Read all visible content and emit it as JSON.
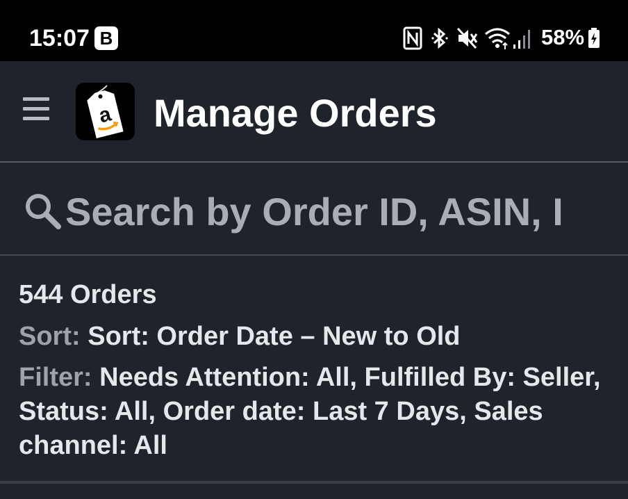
{
  "status_bar": {
    "time": "15:07",
    "badge": "B",
    "battery": "58%",
    "icons": [
      "nfc-icon",
      "bluetooth-icon",
      "mute-icon",
      "wifi-icon",
      "signal-icon",
      "battery-charging-icon"
    ]
  },
  "app_bar": {
    "title": "Manage Orders",
    "logo_letter": "a"
  },
  "search": {
    "placeholder": "Search by Order ID, ASIN, I"
  },
  "summary": {
    "orders_count": "544 Orders",
    "sort_label": "Sort:",
    "sort_value": "Sort: Order Date – New to Old",
    "filter_label": "Filter:",
    "filter_value": "Needs Attention: All, Fulfilled By: Seller, Status: All, Order date: Last 7 Days, Sales channel: All"
  },
  "colors": {
    "background": "#1f232b",
    "status_bar": "#000000",
    "title": "#ffffff",
    "muted_label": "#9ea2aa",
    "logo_orange": "#f59d1b"
  }
}
